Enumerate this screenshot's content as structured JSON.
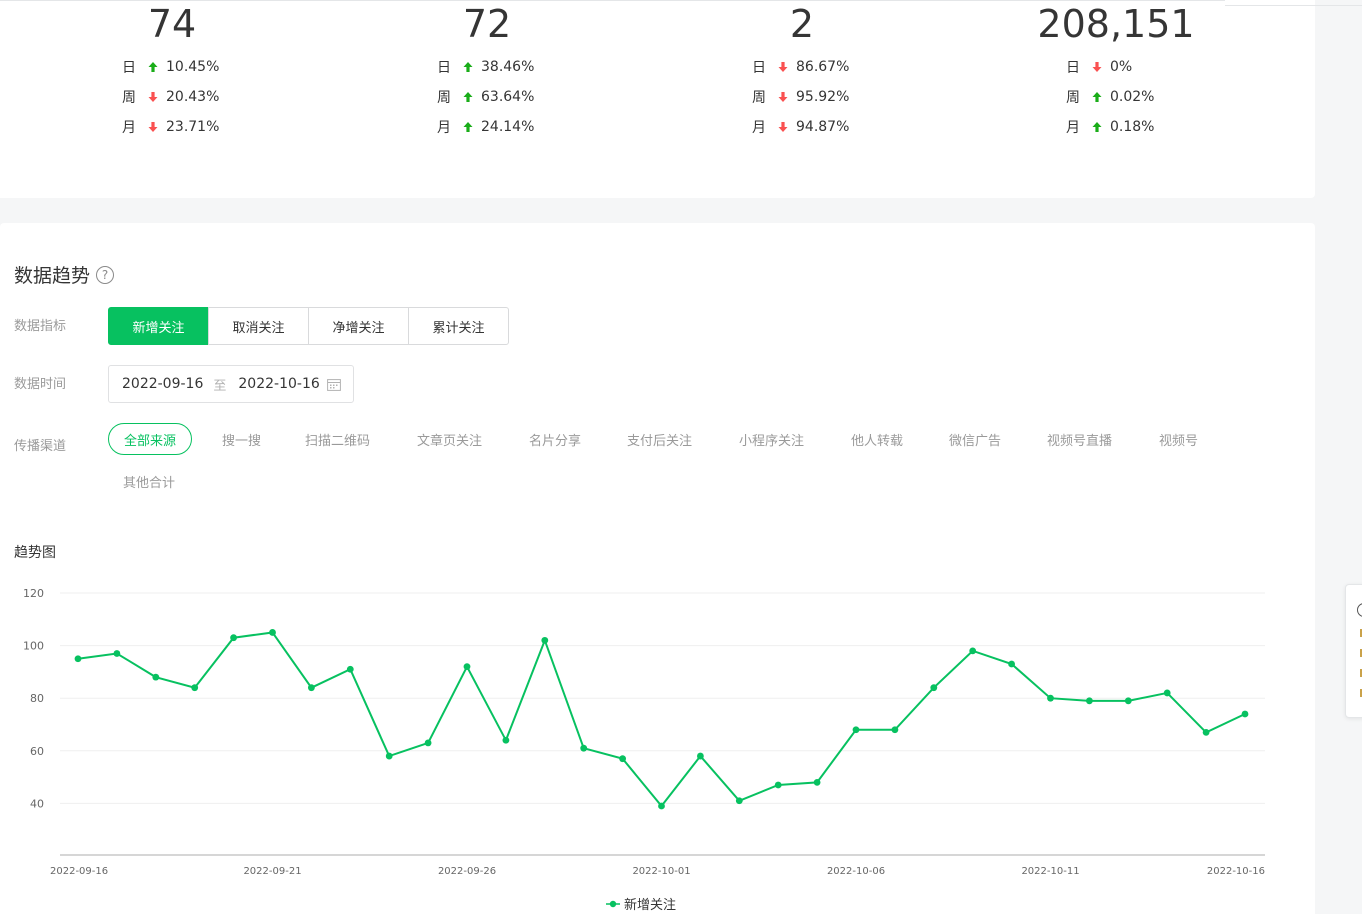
{
  "stats": [
    {
      "value": "74",
      "rows": [
        {
          "label": "日",
          "dir": "up",
          "pct": "10.45%"
        },
        {
          "label": "周",
          "dir": "down",
          "pct": "20.43%"
        },
        {
          "label": "月",
          "dir": "down",
          "pct": "23.71%"
        }
      ]
    },
    {
      "value": "72",
      "rows": [
        {
          "label": "日",
          "dir": "up",
          "pct": "38.46%"
        },
        {
          "label": "周",
          "dir": "up",
          "pct": "63.64%"
        },
        {
          "label": "月",
          "dir": "up",
          "pct": "24.14%"
        }
      ]
    },
    {
      "value": "2",
      "rows": [
        {
          "label": "日",
          "dir": "down",
          "pct": "86.67%"
        },
        {
          "label": "周",
          "dir": "down",
          "pct": "95.92%"
        },
        {
          "label": "月",
          "dir": "down",
          "pct": "94.87%"
        }
      ]
    },
    {
      "value": "208,151",
      "rows": [
        {
          "label": "日",
          "dir": "down",
          "pct": "0%"
        },
        {
          "label": "周",
          "dir": "up",
          "pct": "0.02%"
        },
        {
          "label": "月",
          "dir": "up",
          "pct": "0.18%"
        }
      ]
    }
  ],
  "colors": {
    "up": "#1aad19",
    "down": "#fa5151",
    "accent": "#07c160"
  },
  "section": {
    "title": "数据趋势",
    "help_icon": "?"
  },
  "filters": {
    "metric_label": "数据指标",
    "metrics": [
      "新增关注",
      "取消关注",
      "净增关注",
      "累计关注"
    ],
    "active_metric": 0,
    "time_label": "数据时间",
    "date_start": "2022-09-16",
    "date_sep": "至",
    "date_end": "2022-10-16",
    "channel_label": "传播渠道",
    "channels": [
      "全部来源",
      "搜一搜",
      "扫描二维码",
      "文章页关注",
      "名片分享",
      "支付后关注",
      "小程序关注",
      "他人转载",
      "微信广告",
      "视频号直播",
      "视频号",
      "其他合计"
    ],
    "active_channel": 0
  },
  "trend_title": "趋势图",
  "chart_data": {
    "type": "line",
    "x": [
      "2022-09-16",
      "2022-09-17",
      "2022-09-18",
      "2022-09-19",
      "2022-09-20",
      "2022-09-21",
      "2022-09-22",
      "2022-09-23",
      "2022-09-24",
      "2022-09-25",
      "2022-09-26",
      "2022-09-27",
      "2022-09-28",
      "2022-09-29",
      "2022-09-30",
      "2022-10-01",
      "2022-10-02",
      "2022-10-03",
      "2022-10-04",
      "2022-10-05",
      "2022-10-06",
      "2022-10-07",
      "2022-10-08",
      "2022-10-09",
      "2022-10-10",
      "2022-10-11",
      "2022-10-12",
      "2022-10-13",
      "2022-10-14",
      "2022-10-15",
      "2022-10-16"
    ],
    "x_ticks": [
      "2022-09-16",
      "2022-09-21",
      "2022-09-26",
      "2022-10-01",
      "2022-10-06",
      "2022-10-11",
      "2022-10-16"
    ],
    "series": [
      {
        "name": "新增关注",
        "values": [
          95,
          97,
          88,
          84,
          103,
          105,
          84,
          91,
          58,
          63,
          92,
          64,
          102,
          61,
          57,
          39,
          58,
          41,
          47,
          48,
          68,
          68,
          84,
          98,
          93,
          80,
          79,
          79,
          82,
          67,
          74
        ]
      }
    ],
    "y_ticks": [
      40,
      60,
      80,
      100,
      120
    ],
    "ylim": [
      20,
      120
    ],
    "color": "#07c160",
    "grid": true,
    "legend": "bottom-center"
  }
}
